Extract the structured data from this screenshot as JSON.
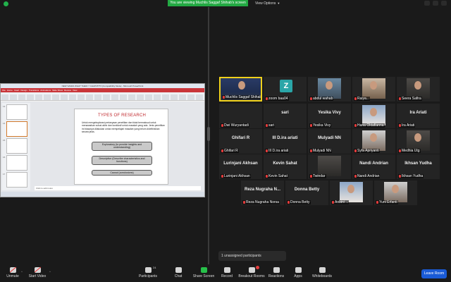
{
  "banner": {
    "viewing_text": "You are viewing Muchlis Saggaf Shihab's screen",
    "view_options": "View Options"
  },
  "ppt": {
    "window_title": "NEW SAVES WHAT THEIR 7 CHAP.PPTX [Compatibility Mode] - Microsoft PowerPoint",
    "menus": [
      "File",
      "Home",
      "Insert",
      "Design",
      "Transitions",
      "Animations",
      "Slide Show",
      "Review",
      "View"
    ],
    "thumb_numbers": [
      "13",
      "14",
      "15",
      "16",
      "17"
    ],
    "slide_title": "TYPES OF RESEARCH",
    "slide_text": "Untuk mengeksplorasi pertanyaan penelitian dan tidak bermaksud untuk menawarkan solusi akhir dan konklusif untuk masalah yang ada. Jenis penelitian ini biasanya dilakukan untuk mempelajari masalah yang belum didefinisikan secara jelas.",
    "boxes": [
      "Exploratory (to provide insights and understanding)",
      "Descriptive (Describe characteristics and functions)",
      "Causal (conclusions)"
    ],
    "notes": "Click to add notes"
  },
  "participants": [
    {
      "name": "Muchlis Saggaf Shihab",
      "big": "",
      "video": "suit",
      "active": true
    },
    {
      "name": "zoom baa04",
      "big": "",
      "video": "z-avatar",
      "avatar_letter": "Z"
    },
    {
      "name": "abdul wahab",
      "big": "",
      "video": "a"
    },
    {
      "name": "Raiya...",
      "big": "",
      "video": "b"
    },
    {
      "name": "Seera Safira",
      "big": "",
      "video": "c"
    },
    {
      "name": "Dwi Wuryantadi",
      "big": "",
      "video": "none"
    },
    {
      "name": "sari",
      "big": "sari",
      "video": "none"
    },
    {
      "name": "Yesika Vivy",
      "big": "Yesika Vivy",
      "video": "none"
    },
    {
      "name": "Hana Oktafianna",
      "big": "",
      "video": "d"
    },
    {
      "name": "Ira Ariati",
      "big": "Ira Ariati",
      "video": "none"
    },
    {
      "name": "Ghifari R",
      "big": "Ghifari R",
      "video": "none"
    },
    {
      "name": "III D.ira ariati",
      "big": "III D.ira ariati",
      "video": "none"
    },
    {
      "name": "Mulyadi NN",
      "big": "Mulyadi NN",
      "video": "none"
    },
    {
      "name": "Syfa Apriyanti",
      "big": "",
      "video": "e"
    },
    {
      "name": "Medhia Utg",
      "big": "",
      "video": "c"
    },
    {
      "name": "Lurinjani Akhsan",
      "big": "Lurinjani Akhsan",
      "video": "none"
    },
    {
      "name": "Kevin Sahat",
      "big": "Kevin Sahat",
      "video": "none"
    },
    {
      "name": "Twindar",
      "big": "",
      "video": "dark"
    },
    {
      "name": "Nandi Andrian",
      "big": "Nandi Andrian",
      "video": "none"
    },
    {
      "name": "Ikhsan Yudha",
      "big": "Ikhsan Yudha",
      "video": "none"
    },
    {
      "name": "Reza Nugraha Norsa",
      "big": "Reza Nugraha N...",
      "video": "none"
    },
    {
      "name": "Donna Betty",
      "big": "Donna Betty",
      "video": "none"
    },
    {
      "name": "Anbini ...",
      "big": "",
      "video": "d"
    },
    {
      "name": "Yuni Erfanti",
      "big": "",
      "video": "e"
    }
  ],
  "unassigned": "1 unassigned participants",
  "toolbar": {
    "unmute": "Unmute",
    "start_video": "Start Video",
    "participants": "Participants",
    "participants_count": "24",
    "chat": "Chat",
    "share_screen": "Share Screen",
    "record": "Record",
    "breakout_rooms": "Breakout Rooms",
    "reactions": "Reactions",
    "apps": "Apps",
    "whiteboards": "Whiteboards",
    "leave": "Leave Room"
  },
  "colors": {
    "banner_green": "#23a943",
    "leave_blue": "#1a5bd6",
    "active_speaker": "#f0d11c",
    "slide_title_red": "#c0282d"
  }
}
